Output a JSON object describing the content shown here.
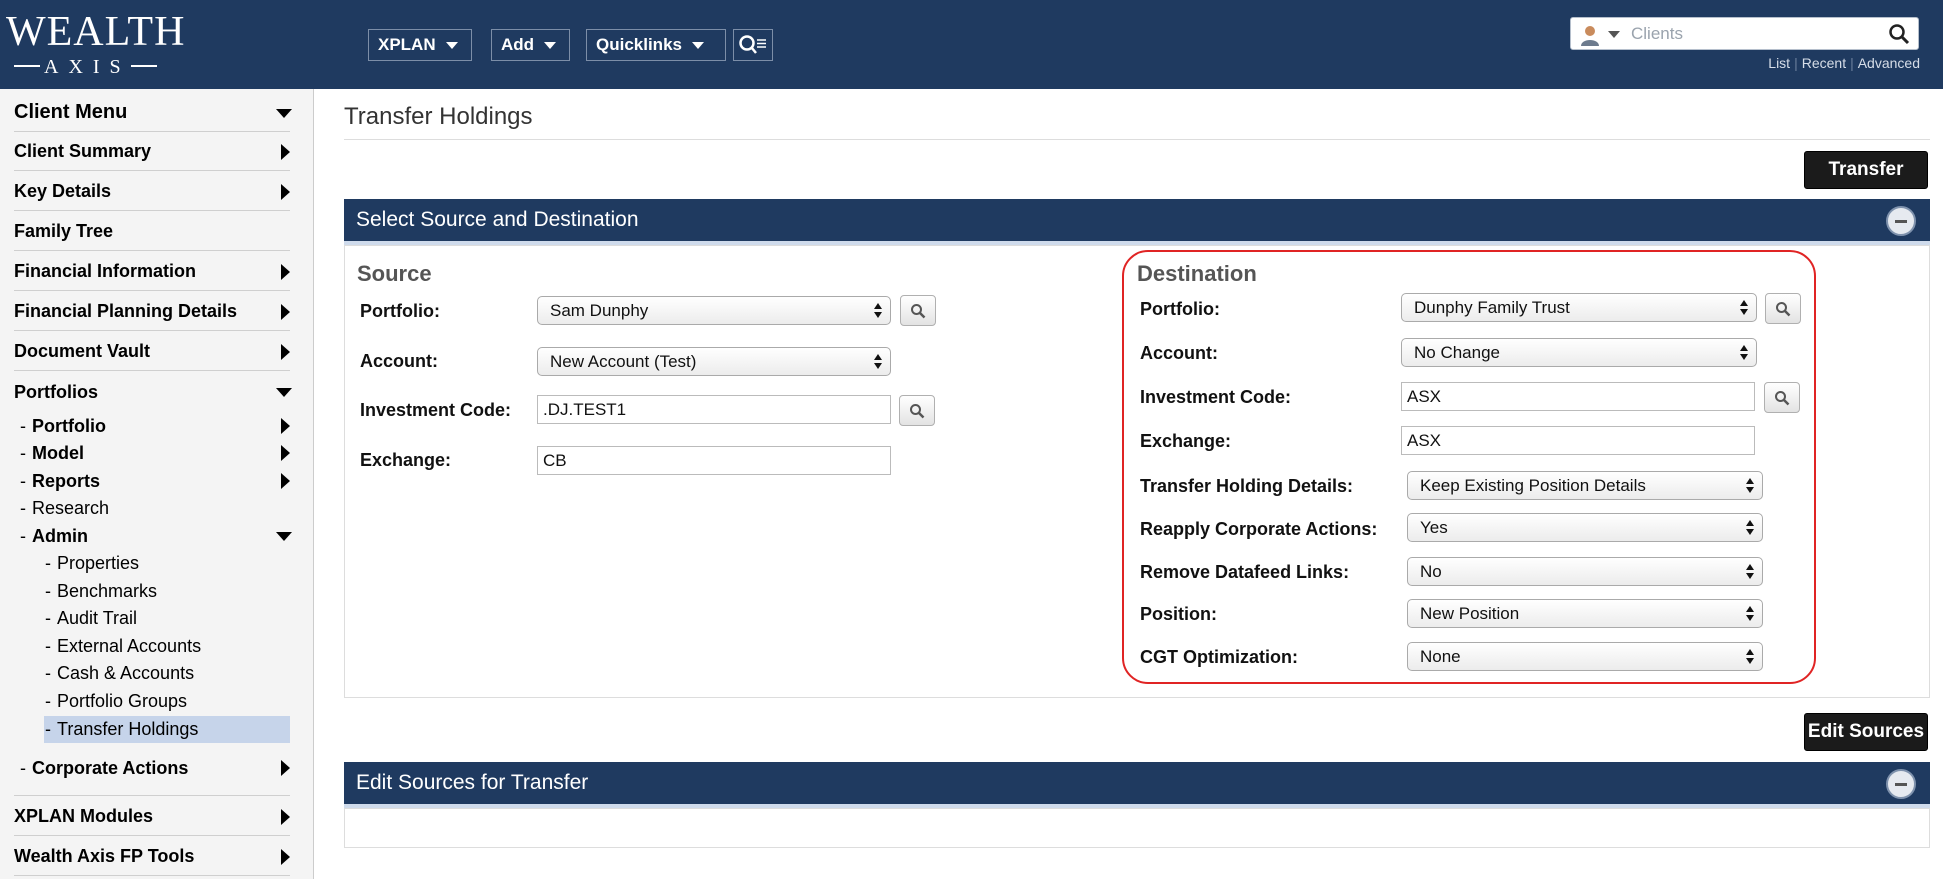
{
  "colors": {
    "header_bg": "#1f3a60",
    "active_item_bg": "#c6d4ea",
    "highlight_border": "#e02424",
    "button_bg": "#1b1b1b"
  },
  "logo": {
    "word": "WEALTH",
    "sub": "AXIS"
  },
  "topnav": {
    "xplan": "XPLAN",
    "add": "Add",
    "quicklinks": "Quicklinks",
    "advanced_search_icon": "search-list-icon"
  },
  "search": {
    "placeholder": "Clients",
    "links": [
      "List",
      "Recent",
      "Advanced"
    ]
  },
  "sidebar": {
    "client_menu": "Client Menu",
    "client_summary": "Client Summary",
    "key_details": "Key Details",
    "family_tree": "Family Tree",
    "financial_information": "Financial Information",
    "financial_planning_details": "Financial Planning Details",
    "document_vault": "Document Vault",
    "portfolios": "Portfolios",
    "portfolios_sub": [
      "Portfolio",
      "Model",
      "Reports",
      "Research",
      "Admin"
    ],
    "admin_sub": [
      "Properties",
      "Benchmarks",
      "Audit Trail",
      "External Accounts",
      "Cash & Accounts",
      "Portfolio Groups",
      "Transfer Holdings"
    ],
    "corporate_actions": "Corporate Actions",
    "xplan_modules": "XPLAN Modules",
    "wealth_axis_fp_tools": "Wealth Axis FP Tools"
  },
  "page": {
    "title": "Transfer Holdings",
    "transfer_button": "Transfer",
    "panel1_title": "Select Source and Destination",
    "edit_sources_button": "Edit Sources",
    "panel2_title": "Edit Sources for Transfer"
  },
  "source": {
    "heading": "Source",
    "portfolio_label": "Portfolio:",
    "portfolio_value": "Sam Dunphy",
    "account_label": "Account:",
    "account_value": "New Account (Test)",
    "investment_code_label": "Investment Code:",
    "investment_code_value": ".DJ.TEST1",
    "exchange_label": "Exchange:",
    "exchange_value": "CB"
  },
  "destination": {
    "heading": "Destination",
    "portfolio_label": "Portfolio:",
    "portfolio_value": "Dunphy Family Trust",
    "account_label": "Account:",
    "account_value": "No Change",
    "investment_code_label": "Investment Code:",
    "investment_code_value": "ASX",
    "exchange_label": "Exchange:",
    "exchange_value": "ASX",
    "transfer_holding_details_label": "Transfer Holding Details:",
    "transfer_holding_details_value": "Keep Existing Position Details",
    "reapply_corporate_actions_label": "Reapply Corporate Actions:",
    "reapply_corporate_actions_value": "Yes",
    "remove_datafeed_links_label": "Remove Datafeed Links:",
    "remove_datafeed_links_value": "No",
    "position_label": "Position:",
    "position_value": "New Position",
    "cgt_optimization_label": "CGT Optimization:",
    "cgt_optimization_value": "None"
  }
}
